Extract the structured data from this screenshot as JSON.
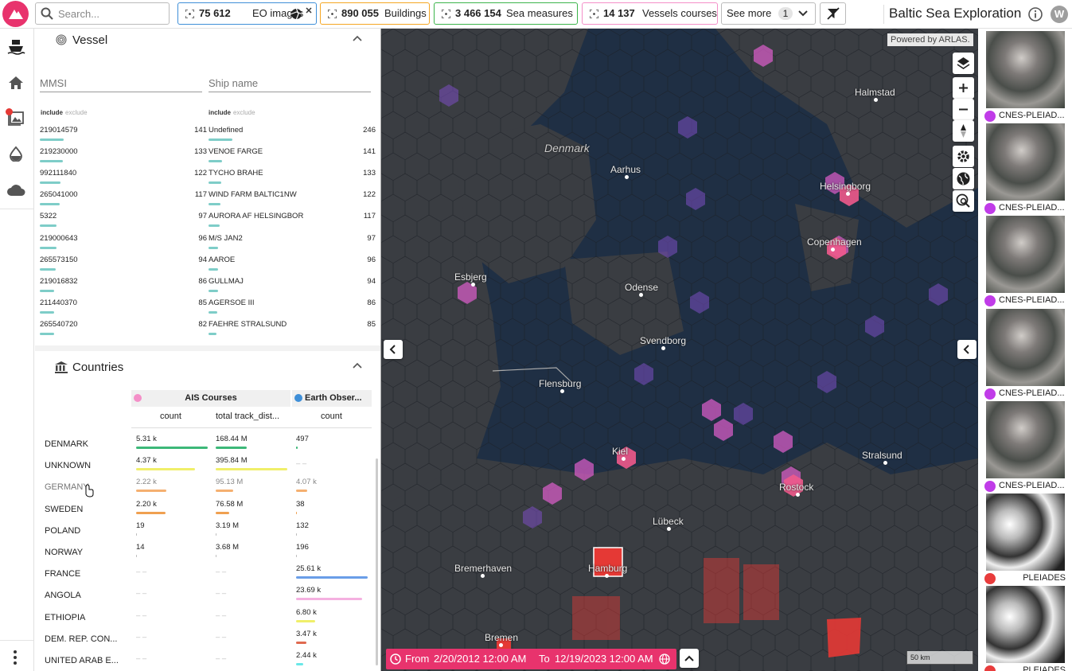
{
  "topbar": {
    "search_placeholder": "Search...",
    "chips": [
      {
        "count": "75 612",
        "label": "EO images",
        "color": "#3f8fd8"
      },
      {
        "count": "890 055",
        "label": "Buildings",
        "color": "#f5a623"
      },
      {
        "count": "3 466 154",
        "label": "Sea measures",
        "color": "#3cb44b"
      },
      {
        "count": "14 137",
        "label": "Vessels courses",
        "color": "#f48fc8"
      }
    ],
    "see_more_label": "See more",
    "see_more_count": "1",
    "app_title": "Baltic Sea Exploration",
    "user_initial": "W"
  },
  "vessel": {
    "title": "Vessel",
    "mmsi_placeholder": "MMSI",
    "shipname_placeholder": "Ship name",
    "include_label": "include",
    "exclude_label": "exclude",
    "bar_color": "#7ecdc8",
    "mmsi_rows": [
      {
        "label": "219014579",
        "count": "141",
        "value": 141
      },
      {
        "label": "219230000",
        "count": "133",
        "value": 133
      },
      {
        "label": "992111840",
        "count": "122",
        "value": 122
      },
      {
        "label": "265041000",
        "count": "117",
        "value": 117
      },
      {
        "label": "5322",
        "count": "97",
        "value": 97
      },
      {
        "label": "219000643",
        "count": "96",
        "value": 96
      },
      {
        "label": "265573150",
        "count": "94",
        "value": 94
      },
      {
        "label": "219016832",
        "count": "86",
        "value": 86
      },
      {
        "label": "211440370",
        "count": "85",
        "value": 85
      },
      {
        "label": "265540720",
        "count": "82",
        "value": 82
      }
    ],
    "name_rows": [
      {
        "label": "Undefined",
        "count": "246",
        "value": 246
      },
      {
        "label": "VENOE FARGE",
        "count": "141",
        "value": 141
      },
      {
        "label": "TYCHO BRAHE",
        "count": "133",
        "value": 133
      },
      {
        "label": "WIND FARM BALTIC1NW",
        "count": "122",
        "value": 122
      },
      {
        "label": "AURORA AF HELSINGBOR",
        "count": "117",
        "value": 117
      },
      {
        "label": "M/S JAN2",
        "count": "97",
        "value": 97
      },
      {
        "label": "AAROE",
        "count": "96",
        "value": 96
      },
      {
        "label": "GULLMAJ",
        "count": "94",
        "value": 94
      },
      {
        "label": "AGERSOE III",
        "count": "86",
        "value": 86
      },
      {
        "label": "FAEHRE STRALSUND",
        "count": "85",
        "value": 85
      }
    ]
  },
  "countries": {
    "title": "Countries",
    "group1": {
      "name": "AIS Courses",
      "color": "#f48fc8"
    },
    "group2": {
      "name": "Earth Obser...",
      "color": "#3f8fd8"
    },
    "col_count": "count",
    "col_track": "total track_dist...",
    "col_count2": "count",
    "empty": "– –",
    "rows": [
      {
        "name": "DENMARK",
        "c1": "5.31 k",
        "v1": 1.0,
        "c2": "168.44 M",
        "v2": 0.43,
        "c3": "497",
        "v3": 0.02,
        "color": "#3cb878"
      },
      {
        "name": "UNKNOWN",
        "c1": "4.37 k",
        "v1": 0.82,
        "c2": "395.84 M",
        "v2": 1.0,
        "c3": "",
        "v3": 0,
        "color": "#f0ef6a"
      },
      {
        "name": "GERMANY",
        "c1": "2.22 k",
        "v1": 0.42,
        "c2": "95.13 M",
        "v2": 0.24,
        "c3": "4.07 k",
        "v3": 0.16,
        "color": "#f5b070"
      },
      {
        "name": "SWEDEN",
        "c1": "2.20 k",
        "v1": 0.41,
        "c2": "76.58 M",
        "v2": 0.19,
        "c3": "38",
        "v3": 0.01,
        "color": "#f0a050"
      },
      {
        "name": "POLAND",
        "c1": "19",
        "v1": 0.004,
        "c2": "3.19 M",
        "v2": 0.01,
        "c3": "132",
        "v3": 0.005,
        "color": "#bbbbbb"
      },
      {
        "name": "NORWAY",
        "c1": "14",
        "v1": 0.003,
        "c2": "3.68 M",
        "v2": 0.01,
        "c3": "196",
        "v3": 0.008,
        "color": "#bbbbbb"
      },
      {
        "name": "FRANCE",
        "c1": "",
        "v1": 0,
        "c2": "",
        "v2": 0,
        "c3": "25.61 k",
        "v3": 1.0,
        "color": "#6a9ee8"
      },
      {
        "name": "ANGOLA",
        "c1": "",
        "v1": 0,
        "c2": "",
        "v2": 0,
        "c3": "23.69 k",
        "v3": 0.92,
        "color": "#f4b0e0"
      },
      {
        "name": "ETHIOPIA",
        "c1": "",
        "v1": 0,
        "c2": "",
        "v2": 0,
        "c3": "6.80 k",
        "v3": 0.27,
        "color": "#f0ef6a"
      },
      {
        "name": "DEM. REP. CON...",
        "c1": "",
        "v1": 0,
        "c2": "",
        "v2": 0,
        "c3": "3.47 k",
        "v3": 0.14,
        "color": "#e06a50"
      },
      {
        "name": "UNITED ARAB E...",
        "c1": "",
        "v1": 0,
        "c2": "",
        "v2": 0,
        "c3": "2.44 k",
        "v3": 0.1,
        "color": "#6ae8e8"
      }
    ]
  },
  "map": {
    "attribution": "Powered by ARLAS.",
    "cities": [
      "Halmstad",
      "Denmark",
      "Aarhus",
      "Helsingborg",
      "Copenhagen",
      "Esbjerg",
      "Odense",
      "Svendborg",
      "Flensburg",
      "Kiel",
      "Rostock",
      "Stralsund",
      "Lübeck",
      "Bremerhaven",
      "Hamburg",
      "Bremen"
    ],
    "scale": "50 km",
    "time_from_label": "From",
    "time_from": "2/20/2012 12:00 AM",
    "time_to_label": "To",
    "time_to": "12/19/2023 12:00 AM"
  },
  "thumbnails": [
    {
      "caption": "CNES-PLEIAD...",
      "dot": "#c03ce8"
    },
    {
      "caption": "CNES-PLEIAD...",
      "dot": "#c03ce8"
    },
    {
      "caption": "CNES-PLEIAD...",
      "dot": "#c03ce8"
    },
    {
      "caption": "CNES-PLEIAD...",
      "dot": "#c03ce8"
    },
    {
      "caption": "CNES-PLEIAD...",
      "dot": "#c03ce8"
    },
    {
      "caption": "PLEIADES",
      "dot": "#e83c3c"
    },
    {
      "caption": "PLEIADES",
      "dot": "#e83c3c"
    }
  ]
}
